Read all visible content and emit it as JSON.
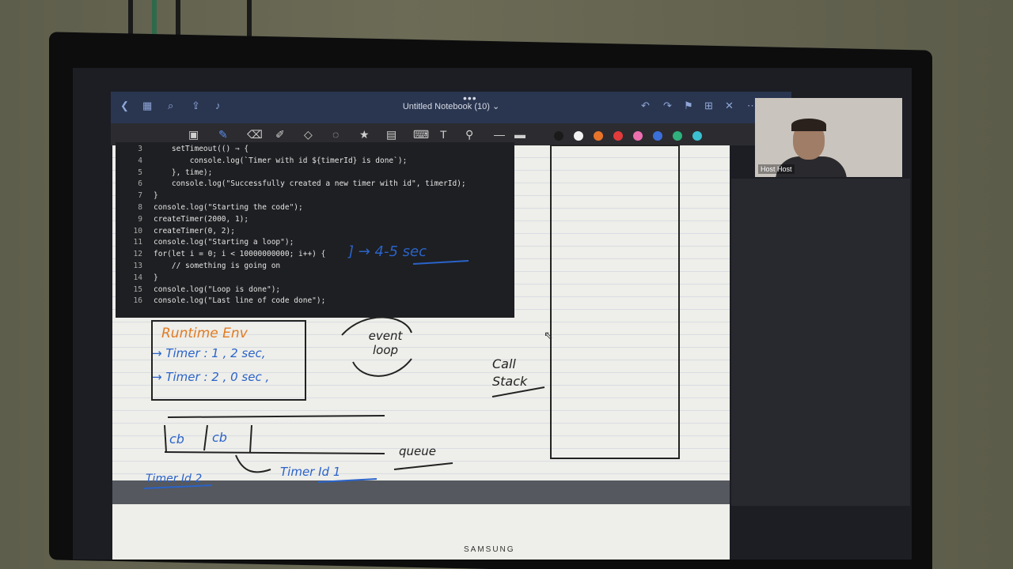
{
  "notebook": {
    "title": "Untitled Notebook (10) ⌄",
    "menu_dots": "•••"
  },
  "code_lines": [
    {
      "n": "3",
      "t": "    setTimeout(() ⇒ {"
    },
    {
      "n": "4",
      "t": "        console.log(`Timer with id ${timerId} is done`);"
    },
    {
      "n": "5",
      "t": "    }, time);"
    },
    {
      "n": "6",
      "t": "    console.log(\"Successfully created a new timer with id\", timerId);"
    },
    {
      "n": "7",
      "t": "}"
    },
    {
      "n": "8",
      "t": "console.log(\"Starting the code\");"
    },
    {
      "n": "9",
      "t": "createTimer(2000, 1);"
    },
    {
      "n": "10",
      "t": "createTimer(0, 2);"
    },
    {
      "n": "11",
      "t": "console.log(\"Starting a loop\");"
    },
    {
      "n": "12",
      "t": "for(let i = 0; i < 10000000000; i++) {"
    },
    {
      "n": "13",
      "t": "    // something is going on"
    },
    {
      "n": "14",
      "t": "}"
    },
    {
      "n": "15",
      "t": "console.log(\"Loop is done\");"
    },
    {
      "n": "16",
      "t": "console.log(\"Last line of code done\");"
    }
  ],
  "handwriting": {
    "runtime_env": "Runtime   Env",
    "timer1": "→ Timer : 1 , 2 sec,",
    "timer2": "→ Timer : 2 , 0 sec ,",
    "event_loop": "event loop",
    "call_stack": "Call Stack",
    "cb1": "cb",
    "cb2": "cb",
    "timer_id_2": "Timer Id 2",
    "timer_id_1": "Timer Id 1",
    "queue": "queue",
    "annotation": "] → 4-5 sec"
  },
  "video": {
    "participant_name": "Host Host"
  },
  "monitor_brand": "SAMSUNG",
  "colors": {
    "accent_blue": "#2a63c9",
    "runtime_orange": "#e07a22"
  },
  "swatches": [
    "#1a1a1a",
    "#f2f2f2",
    "#e8742a",
    "#e23b3b",
    "#ee6fb0",
    "#3b6fd9",
    "#2fb07c",
    "#3bc0d0"
  ]
}
